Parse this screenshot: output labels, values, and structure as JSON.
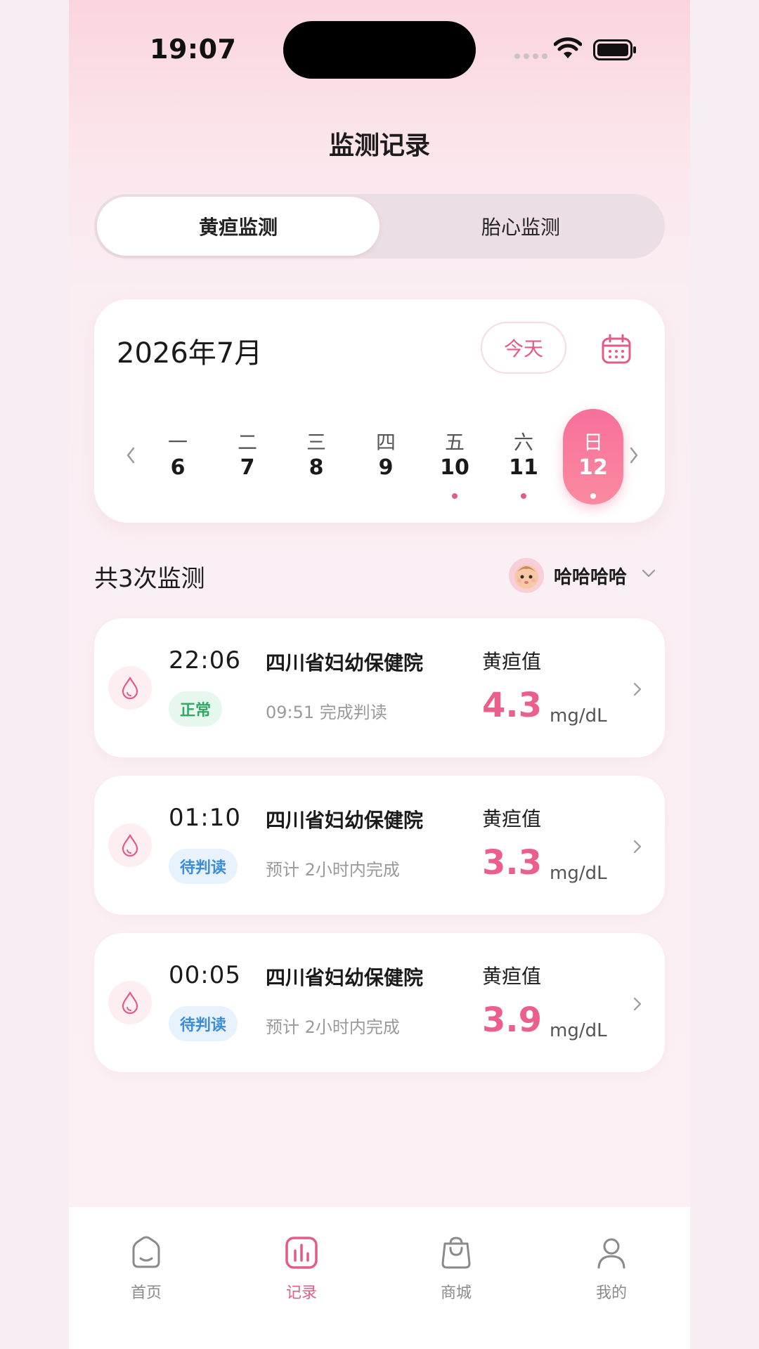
{
  "status_bar": {
    "time": "19:07"
  },
  "header": {
    "title": "监测记录"
  },
  "tabs": [
    {
      "label": "黄疸监测",
      "active": true
    },
    {
      "label": "胎心监测",
      "active": false
    }
  ],
  "calendar": {
    "month": "2026年7月",
    "today_label": "今天",
    "days": [
      {
        "weekday": "一",
        "date": "6",
        "has_record": false,
        "selected": false
      },
      {
        "weekday": "二",
        "date": "7",
        "has_record": false,
        "selected": false
      },
      {
        "weekday": "三",
        "date": "8",
        "has_record": false,
        "selected": false
      },
      {
        "weekday": "四",
        "date": "9",
        "has_record": false,
        "selected": false
      },
      {
        "weekday": "五",
        "date": "10",
        "has_record": true,
        "selected": false
      },
      {
        "weekday": "六",
        "date": "11",
        "has_record": true,
        "selected": false
      },
      {
        "weekday": "日",
        "date": "12",
        "has_record": true,
        "selected": true
      }
    ]
  },
  "summary": {
    "count_text": "共3次监测",
    "baby_name": "哈哈哈哈"
  },
  "records": [
    {
      "time": "22:06",
      "hospital": "四川省妇幼保健院",
      "status": "正常",
      "status_type": "normal",
      "subtitle": "09:51 完成判读",
      "label": "黄疸值",
      "value": "4.3",
      "unit": "mg/dL"
    },
    {
      "time": "01:10",
      "hospital": "四川省妇幼保健院",
      "status": "待判读",
      "status_type": "pending",
      "subtitle": "预计 2小时内完成",
      "label": "黄疸值",
      "value": "3.3",
      "unit": "mg/dL"
    },
    {
      "time": "00:05",
      "hospital": "四川省妇幼保健院",
      "status": "待判读",
      "status_type": "pending",
      "subtitle": "预计 2小时内完成",
      "label": "黄疸值",
      "value": "3.9",
      "unit": "mg/dL"
    }
  ],
  "tabbar": [
    {
      "label": "首页",
      "icon": "home-icon",
      "active": false
    },
    {
      "label": "记录",
      "icon": "records-chart-icon",
      "active": true
    },
    {
      "label": "商城",
      "icon": "shop-bag-icon",
      "active": false
    },
    {
      "label": "我的",
      "icon": "profile-icon",
      "active": false
    }
  ],
  "colors": {
    "accent": "#E45B8A",
    "normal_badge": "#2FA862",
    "pending_badge": "#3B8DD8"
  }
}
